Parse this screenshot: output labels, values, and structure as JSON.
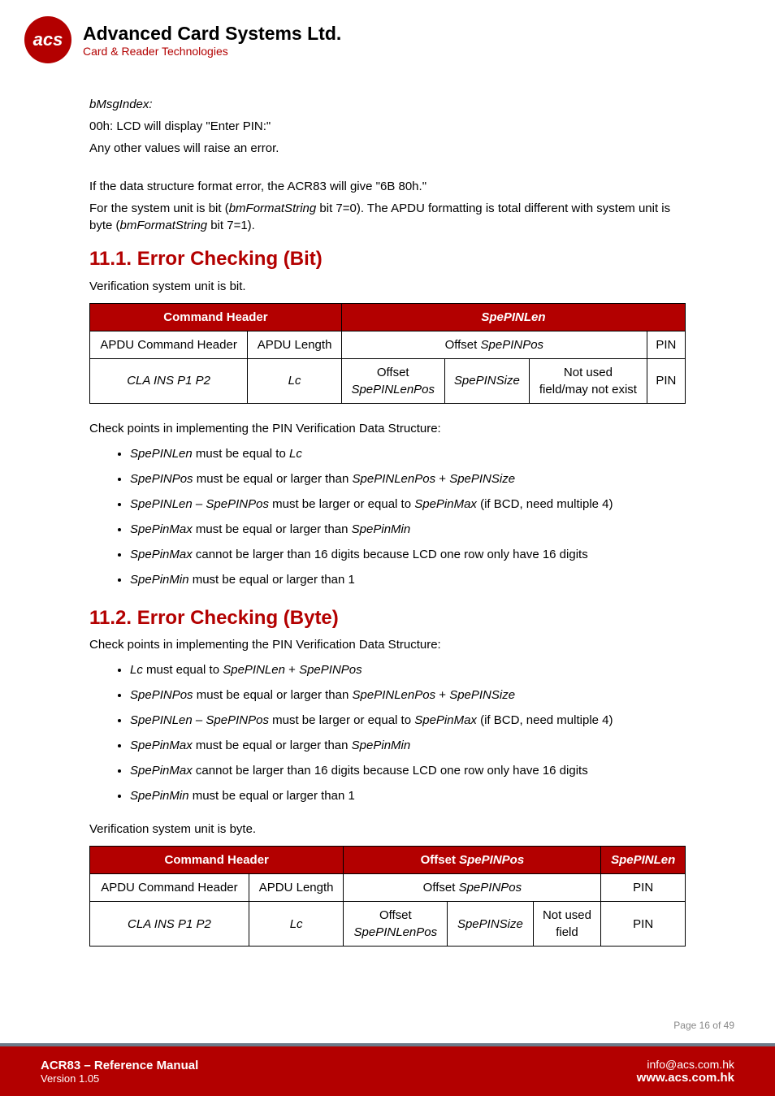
{
  "header": {
    "logo_text": "acs",
    "company_name": "Advanced Card Systems Ltd.",
    "tagline": "Card & Reader Technologies"
  },
  "body": {
    "bMsgIndex_label": "bMsgIndex:",
    "bMsgIndex_00h": "00h: LCD will display \"Enter PIN:\"",
    "bMsgIndex_other": "Any other values will raise an error.",
    "format_error": "If the data structure format error, the ACR83 will give \"6B 80h.\"",
    "system_unit_prefix": "For the system unit is bit (",
    "system_unit_italic1": "bmFormatString",
    "system_unit_mid1": " bit 7=0). The APDU formatting is total different with system unit is byte (",
    "system_unit_italic2": "bmFormatString",
    "system_unit_suffix": " bit 7=1)."
  },
  "section_11_1": {
    "heading": "11.1.  Error Checking (Bit)",
    "intro": "Verification system unit is bit.",
    "table": {
      "headers": {
        "command_header": "Command Header",
        "spe_pin_len": "SpePINLen"
      },
      "row1": {
        "apdu_command_header": "APDU Command Header",
        "apdu_length": "APDU Length",
        "offset_spepinpos_prefix": "Offset ",
        "offset_spepinpos_italic": "SpePINPos",
        "pin": "PIN"
      },
      "row2": {
        "cla_ins": "CLA INS P1 P2",
        "lc": "Lc",
        "offset_spepinlenpos_top": "Offset",
        "offset_spepinlenpos_bottom": "SpePINLenPos",
        "spepinsize": "SpePINSize",
        "not_used_top": "Not used",
        "not_used_bottom": "field/may not exist",
        "pin": "PIN"
      }
    },
    "checkpoints_intro": "Check points in implementing the PIN Verification Data Structure:",
    "bullets": [
      {
        "parts": [
          {
            "i": "SpePINLen"
          },
          {
            "t": " must be equal to "
          },
          {
            "i": "Lc"
          }
        ]
      },
      {
        "parts": [
          {
            "i": "SpePINPos"
          },
          {
            "t": " must be equal or larger than "
          },
          {
            "i": "SpePINLenPos"
          },
          {
            "t": " + "
          },
          {
            "i": "SpePINSize"
          }
        ]
      },
      {
        "parts": [
          {
            "i": "SpePINLen – SpePINPos"
          },
          {
            "t": " must be larger or equal to "
          },
          {
            "i": "SpePinMax"
          },
          {
            "t": " (if BCD, need multiple 4)"
          }
        ]
      },
      {
        "parts": [
          {
            "i": "SpePinMax"
          },
          {
            "t": " must be equal or larger than "
          },
          {
            "i": "SpePinMin"
          }
        ]
      },
      {
        "parts": [
          {
            "i": "SpePinMax"
          },
          {
            "t": " cannot be larger than 16 digits because LCD one row only have 16 digits"
          }
        ]
      },
      {
        "parts": [
          {
            "i": "SpePinMin"
          },
          {
            "t": " must be equal or larger than 1"
          }
        ]
      }
    ]
  },
  "section_11_2": {
    "heading": "11.2. Error Checking (Byte)",
    "intro": "Check points in implementing the PIN Verification Data Structure:",
    "bullets": [
      {
        "parts": [
          {
            "i": "Lc"
          },
          {
            "t": " must equal to "
          },
          {
            "i": "SpePINLen"
          },
          {
            "t": " + "
          },
          {
            "i": "SpePINPos"
          }
        ]
      },
      {
        "parts": [
          {
            "i": "SpePINPos"
          },
          {
            "t": " must be equal or larger than "
          },
          {
            "i": "SpePINLenPos"
          },
          {
            "t": " + "
          },
          {
            "i": "SpePINSize"
          }
        ]
      },
      {
        "parts": [
          {
            "i": "SpePINLen – SpePINPos"
          },
          {
            "t": " must be larger or equal to "
          },
          {
            "i": "SpePinMax"
          },
          {
            "t": " (if BCD, need multiple 4)"
          }
        ]
      },
      {
        "parts": [
          {
            "i": "SpePinMax"
          },
          {
            "t": " must be equal or larger than "
          },
          {
            "i": "SpePinMin"
          }
        ]
      },
      {
        "parts": [
          {
            "i": "SpePinMax"
          },
          {
            "t": " cannot be larger than 16 digits because LCD one row only have 16 digits"
          }
        ]
      },
      {
        "parts": [
          {
            "i": "SpePinMin"
          },
          {
            "t": " must be equal or larger than 1"
          }
        ]
      }
    ],
    "verify_byte": "Verification system unit is byte.",
    "table": {
      "headers": {
        "command_header": "Command Header",
        "offset_prefix": "Offset ",
        "offset_italic": "SpePINPos",
        "spe_pin_len": "SpePINLen"
      },
      "row1": {
        "apdu_command_header": "APDU Command Header",
        "apdu_length": "APDU Length",
        "offset_spepinpos_prefix": "Offset ",
        "offset_spepinpos_italic": "SpePINPos",
        "pin": "PIN"
      },
      "row2": {
        "cla_ins": "CLA INS P1 P2",
        "lc": "Lc",
        "offset_spepinlenpos_top": "Offset",
        "offset_spepinlenpos_bottom": "SpePINLenPos",
        "spepinsize": "SpePINSize",
        "not_used_top": "Not used",
        "not_used_bottom": "field",
        "pin": "PIN"
      }
    }
  },
  "page_num": "Page 16 of 49",
  "footer": {
    "title": "ACR83 – Reference Manual",
    "version": "Version 1.05",
    "email": "info@acs.com.hk",
    "site": "www.acs.com.hk"
  }
}
